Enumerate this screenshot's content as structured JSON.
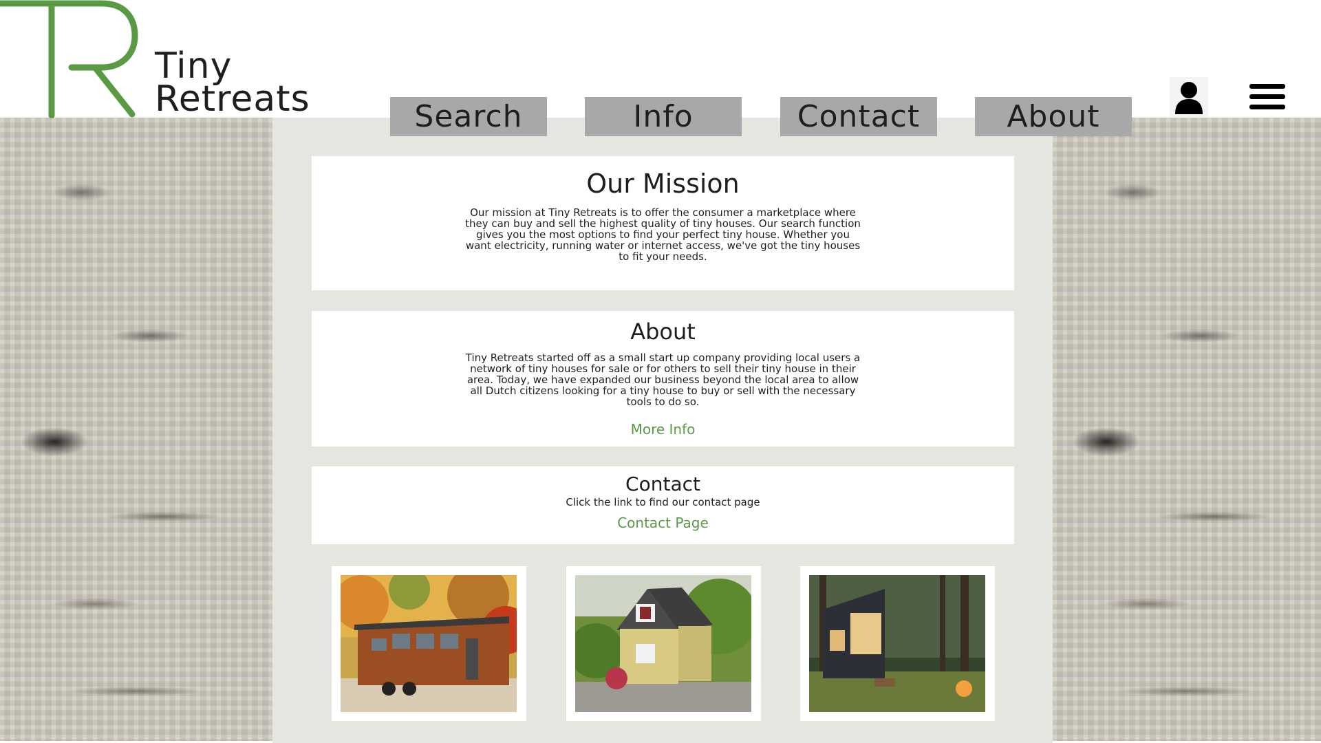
{
  "brand": {
    "name_line1": "Tiny",
    "name_line2": "Retreats",
    "logo_letters": "TR",
    "accent_color": "#5a9a45"
  },
  "nav": {
    "items": [
      {
        "label": "Search"
      },
      {
        "label": "Info"
      },
      {
        "label": "Contact"
      },
      {
        "label": "About"
      }
    ],
    "user_icon": "user-icon",
    "menu_icon": "hamburger-menu-icon"
  },
  "mission": {
    "title": "Our Mission",
    "body": "Our mission at Tiny Retreats is to offer the consumer a marketplace where they can buy and sell the highest quality of tiny houses. Our search function gives you the most options to find your perfect tiny house. Whether you want electricity, running water or internet access, we've got the tiny houses to fit your needs."
  },
  "about": {
    "title": "About",
    "body": "Tiny Retreats started off as a small start up company providing local users a network of tiny houses for sale or for others to sell their tiny house in their area. Today, we have expanded our business beyond the local area to allow all Dutch citizens looking for a tiny house to buy or sell with the necessary tools to do so.",
    "link": "More Info"
  },
  "contact": {
    "title": "Contact",
    "body": "Click the link to find our contact page",
    "link": "Contact Page"
  },
  "photos": [
    {
      "subject": "wooden tiny house on trailer in autumn forest"
    },
    {
      "subject": "yellow cottage tiny house in garden"
    },
    {
      "subject": "modern dark tiny house in woods at dusk"
    }
  ]
}
